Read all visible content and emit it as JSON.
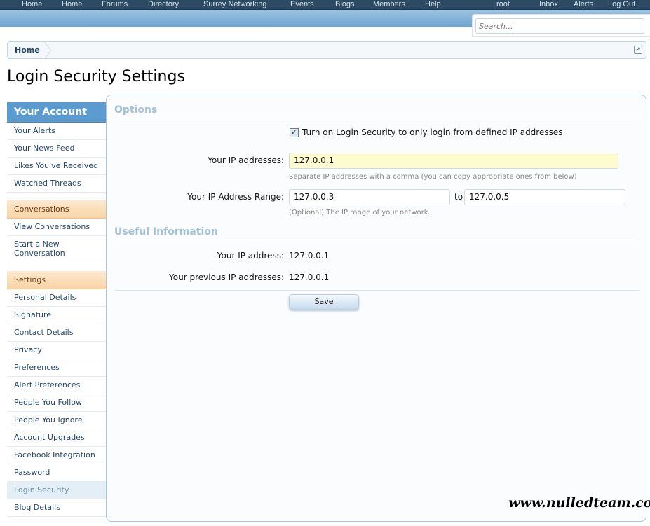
{
  "nav": {
    "items": [
      "Home",
      "Home",
      "Forums",
      "Directory",
      "Surrey Networking",
      "Events",
      "Blogs",
      "Members",
      "Help"
    ],
    "right": [
      "root",
      "Inbox",
      "Alerts",
      "Log Out"
    ]
  },
  "search": {
    "placeholder": "Search..."
  },
  "breadcrumb": {
    "home": "Home"
  },
  "page_title": "Login Security Settings",
  "sidebar": {
    "account_head": "Your Account",
    "account_items": [
      "Your Alerts",
      "Your News Feed",
      "Likes You've Received",
      "Watched Threads"
    ],
    "conv_head": "Conversations",
    "conv_items": [
      "View Conversations",
      "Start a New Conversation"
    ],
    "settings_head": "Settings",
    "settings_items": [
      "Personal Details",
      "Signature",
      "Contact Details",
      "Privacy",
      "Preferences",
      "Alert Preferences",
      "People You Follow",
      "People You Ignore",
      "Account Upgrades",
      "Facebook Integration",
      "Password",
      "Login Security",
      "Blog Details"
    ],
    "active": "Login Security"
  },
  "form": {
    "options_head": "Options",
    "checkbox_label": "Turn on Login Security to only login from defined IP addresses",
    "checkbox_checked": true,
    "ip_label": "Your IP addresses:",
    "ip_value": "127.0.0.1",
    "ip_hint": "Separate IP addresses with a comma (you can copy appropriate ones from below)",
    "range_label": "Your IP Address Range:",
    "range_from": "127.0.0.3",
    "range_to_label": "to",
    "range_to": "127.0.0.5",
    "range_hint": "(Optional) The IP range of your network",
    "info_head": "Useful Information",
    "current_ip_label": "Your IP address:",
    "current_ip": "127.0.0.1",
    "prev_ip_label": "Your previous IP addresses:",
    "prev_ip": "127.0.0.1",
    "save": "Save"
  },
  "watermark": "www.nulledteam.com"
}
